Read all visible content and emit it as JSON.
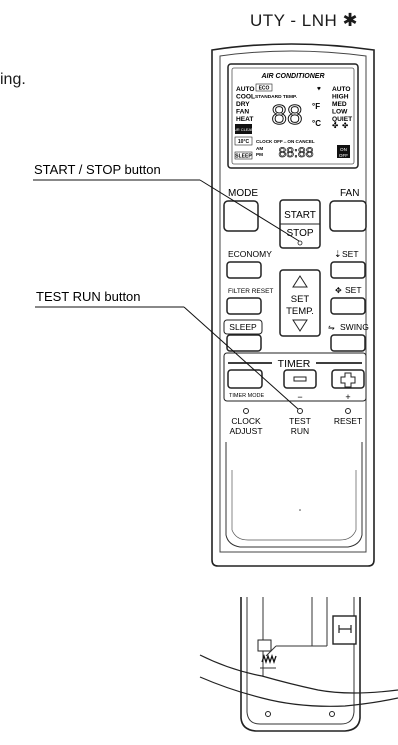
{
  "model": "UTY - LNH",
  "model_mark": "✱",
  "left_fragment": "ing.",
  "callouts": {
    "start_stop": "START / STOP button",
    "test_run": "TEST RUN button"
  },
  "display": {
    "header": "AIR CONDITIONER",
    "modes": [
      "AUTO",
      "COOL",
      "DRY",
      "FAN",
      "HEAT"
    ],
    "eco": "ECO",
    "standard_temp": "STANDARD TEMP.",
    "fan_speeds": [
      "AUTO",
      "HIGH",
      "MED",
      "LOW",
      "QUIET"
    ],
    "temp_digits": "88",
    "unit_f": "°F",
    "unit_c": "°C",
    "fan_symbol": "✤",
    "heart_symbol": "♥",
    "air_clean": "AIR CLEAN",
    "code_10c": "10°C",
    "clock_line": "CLOCK OFF↔ON CANCEL",
    "am": "AM",
    "pm": "PM",
    "time_digits": "88:88",
    "on": "ON",
    "off": "OFF",
    "sleep": "SLEEP"
  },
  "buttons": {
    "mode": "MODE",
    "fan": "FAN",
    "start": "START",
    "stop": "STOP",
    "economy": "ECONOMY",
    "set_up": "SET",
    "filter_reset": "FILTER RESET",
    "set_temp": [
      "SET",
      "TEMP."
    ],
    "set_lr": "SET",
    "sleep": "SLEEP",
    "swing": "SWING",
    "timer": "TIMER",
    "timer_mode": "TIMER MODE",
    "minus": "−",
    "plus": "+",
    "clock_adjust": [
      "CLOCK",
      "ADJUST"
    ],
    "test_run": [
      "TEST",
      "RUN"
    ],
    "reset": "RESET"
  }
}
